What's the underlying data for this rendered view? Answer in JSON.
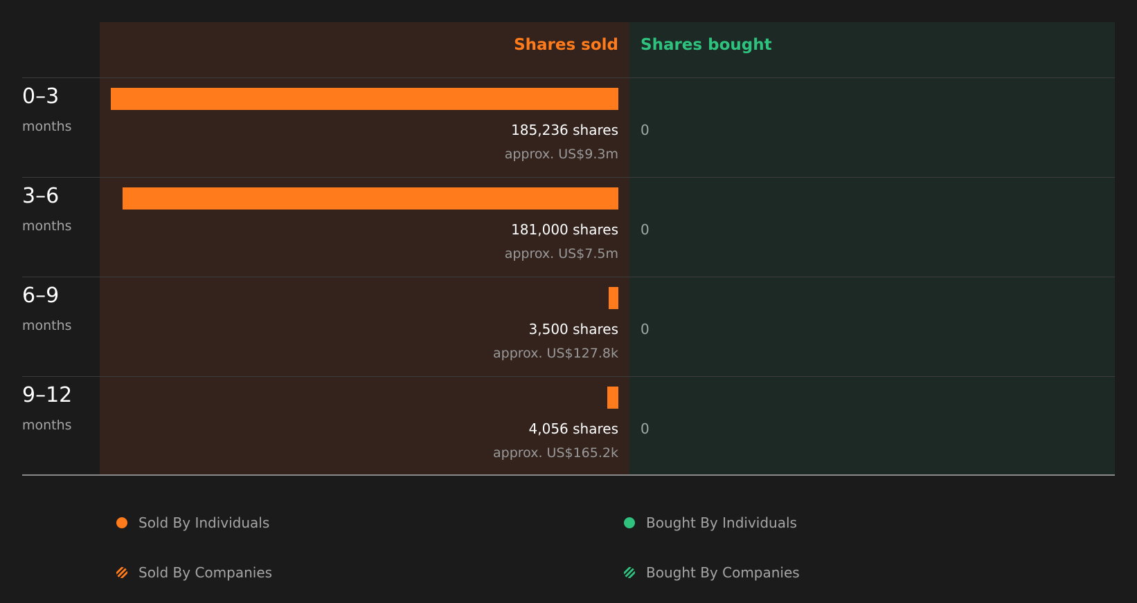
{
  "colors": {
    "sold": "#ff7b1b",
    "bought": "#2ec27e"
  },
  "headers": {
    "sold": "Shares sold",
    "bought": "Shares bought"
  },
  "chart_data": {
    "type": "bar",
    "categories": [
      "0–3 months",
      "3–6 months",
      "6–9 months",
      "9–12 months"
    ],
    "series": [
      {
        "name": "Shares sold",
        "values": [
          185236,
          181000,
          3500,
          4056
        ]
      },
      {
        "name": "Shares bought",
        "values": [
          0,
          0,
          0,
          0
        ]
      }
    ]
  },
  "rows": [
    {
      "period": "0–3",
      "unit": "months",
      "shares": 185236,
      "shares_label": "185,236 shares",
      "value_label": "approx. US$9.3m",
      "bought_label": "0"
    },
    {
      "period": "3–6",
      "unit": "months",
      "shares": 181000,
      "shares_label": "181,000 shares",
      "value_label": "approx. US$7.5m",
      "bought_label": "0"
    },
    {
      "period": "6–9",
      "unit": "months",
      "shares": 3500,
      "shares_label": "3,500 shares",
      "value_label": "approx. US$127.8k",
      "bought_label": "0"
    },
    {
      "period": "9–12",
      "unit": "months",
      "shares": 4056,
      "shares_label": "4,056 shares",
      "value_label": "approx. US$165.2k",
      "bought_label": "0"
    }
  ],
  "legend": [
    {
      "label": "Sold By Individuals",
      "style": "solid-orange"
    },
    {
      "label": "Bought By Individuals",
      "style": "solid-green"
    },
    {
      "label": "Sold By Companies",
      "style": "striped-orange"
    },
    {
      "label": "Bought By Companies",
      "style": "striped-green"
    }
  ]
}
